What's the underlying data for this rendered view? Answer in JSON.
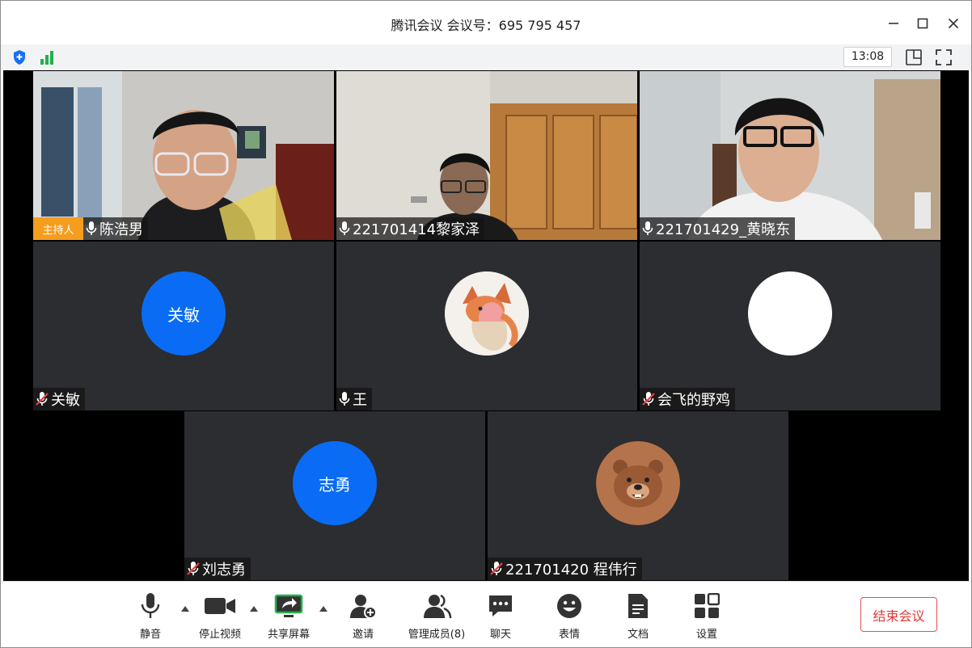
{
  "window": {
    "title": "腾讯会议 会议号：695 795 457"
  },
  "status": {
    "time": "13:08"
  },
  "participants": [
    {
      "name": "陈浩男",
      "role": "主持人",
      "mic": "on",
      "video": true
    },
    {
      "name": "221701414黎家泽",
      "mic": "on",
      "video": true
    },
    {
      "name": "221701429_黄晓东",
      "mic": "on",
      "video": true
    },
    {
      "name": "关敏",
      "avatar_text": "关敏",
      "avatar_color": "#0a6cf5",
      "mic": "muted",
      "video": false
    },
    {
      "name": "王",
      "avatar_text": "",
      "avatar_image": "anime-fox-avatar",
      "mic": "on",
      "video": false
    },
    {
      "name": "会飞的野鸡",
      "avatar_text": "",
      "avatar_color": "#ffffff",
      "mic": "muted",
      "video": false
    },
    {
      "name": "刘志勇",
      "avatar_text": "志勇",
      "avatar_color": "#0a6cf5",
      "mic": "muted",
      "video": false
    },
    {
      "name": "221701420 程伟行",
      "avatar_text": "",
      "avatar_image": "bear-avatar",
      "avatar_color": "#b5734b",
      "mic": "muted",
      "video": false
    }
  ],
  "toolbar": {
    "mute": "静音",
    "stop_video": "停止视频",
    "share_screen": "共享屏幕",
    "invite": "邀请",
    "manage_members": "管理成员(8)",
    "chat": "聊天",
    "emoji": "表情",
    "docs": "文档",
    "settings": "设置",
    "end_meeting": "结束会议"
  },
  "colors": {
    "accent": "#0a6cf5",
    "end_button": "#e03a36",
    "host_badge": "#f59d1e",
    "tile_bg": "#2b2d30",
    "signal": "#22b14c"
  }
}
